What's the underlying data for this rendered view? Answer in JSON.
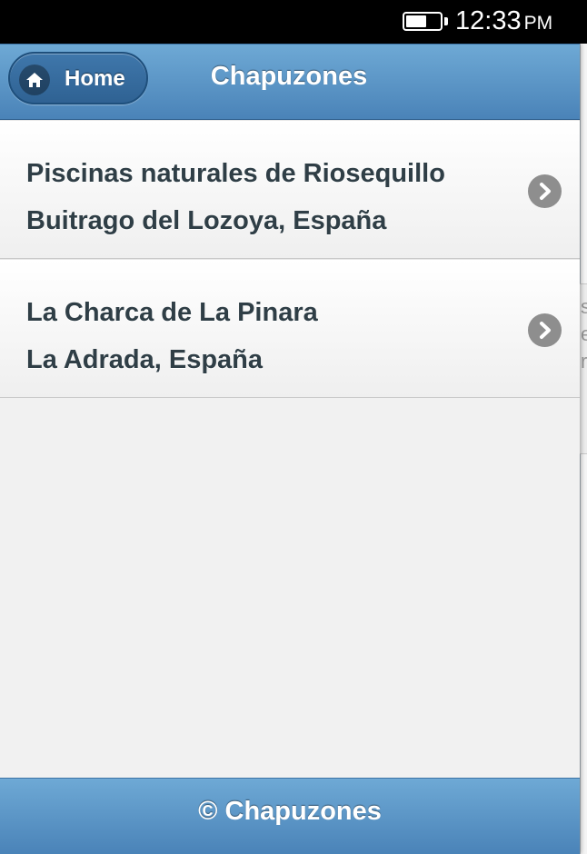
{
  "status_bar": {
    "time": "12:33",
    "ampm": "PM",
    "battery_level": 0.6
  },
  "header": {
    "back_button_label": "Home",
    "back_button_icon": "home-icon",
    "title": "Chapuzones"
  },
  "list": {
    "items": [
      {
        "title": "Piscinas naturales de Riosequillo",
        "subtitle": "Buitrago del Lozoya, España",
        "icon": "chevron-right-icon"
      },
      {
        "title": "La Charca de La Pinara",
        "subtitle": "La Adrada, España",
        "icon": "chevron-right-icon"
      }
    ]
  },
  "footer": {
    "text": "© Chapuzones"
  },
  "background_page": {
    "partial_text": [
      "s",
      "e",
      "r"
    ]
  },
  "colors": {
    "header_bar": "#5a94c7",
    "text": "#2f3e46",
    "chevron": "#8e8e8e",
    "background": "#f1f1f1"
  }
}
